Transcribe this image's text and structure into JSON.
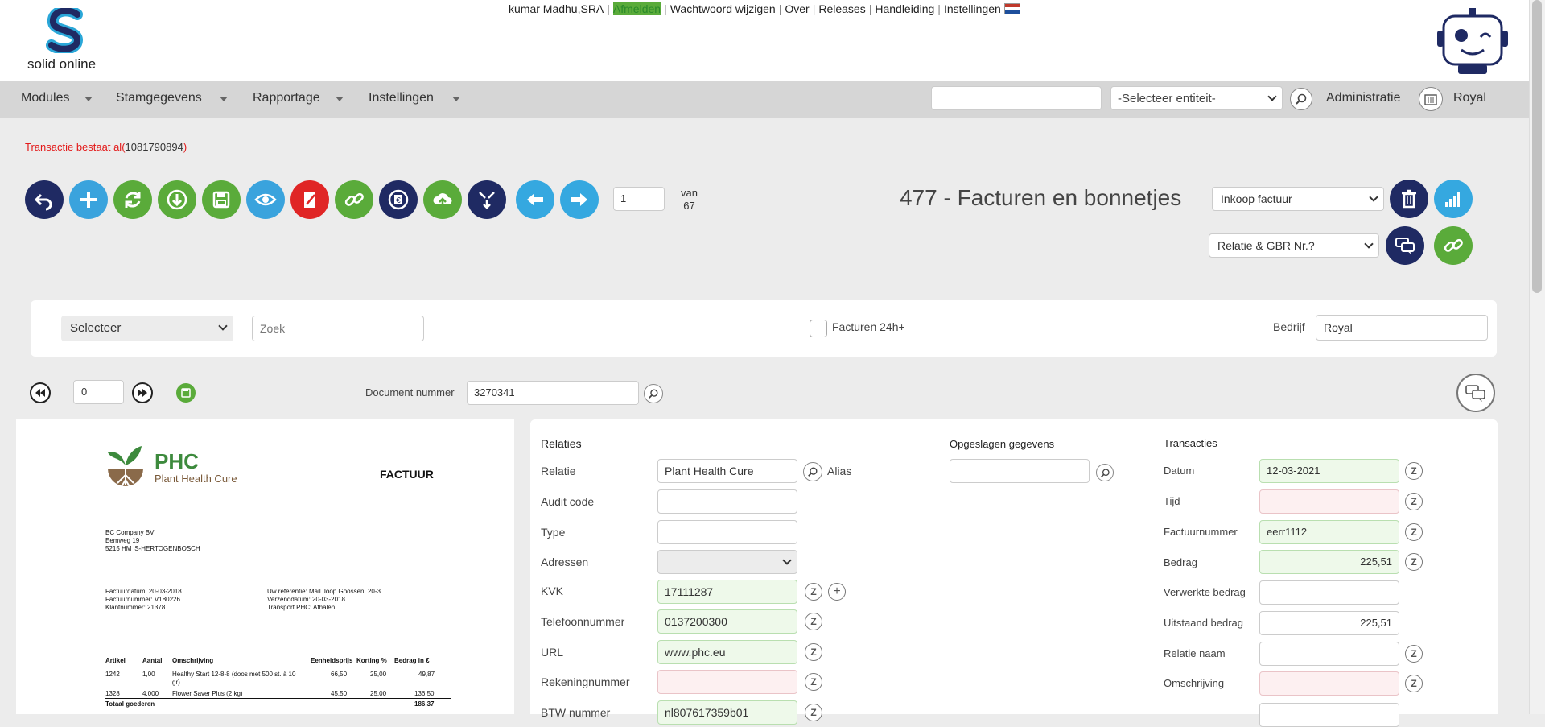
{
  "header": {
    "logo_text": "solid online",
    "user": "kumar Madhu,SRA",
    "links": [
      "Afmelden",
      "Wachtwoord wijzigen",
      "Over",
      "Releases",
      "Handleiding",
      "Instellingen"
    ]
  },
  "nav": {
    "menus": [
      "Modules",
      "Stamgegevens",
      "Rapportage",
      "Instellingen"
    ],
    "entity_select": "-Selecteer entiteit-",
    "admin_label": "Administratie",
    "company": "Royal"
  },
  "message": {
    "text": "Transactie bestaat al(",
    "number": "1081790894",
    "close": ")"
  },
  "toolbar": {
    "page_value": "1",
    "van_label": "van",
    "total_pages": "67",
    "title": "477 - Facturen en bonnetjes",
    "type_select": "Inkoop factuur",
    "relation_select": "Relatie & GBR Nr.?"
  },
  "filter": {
    "select": "Selecteer",
    "search_placeholder": "Zoek",
    "facturen_label": "Facturen 24h+",
    "bedrijf_label": "Bedrijf",
    "bedrijf_value": "Royal"
  },
  "docnav": {
    "index": "0",
    "docnum_label": "Document nummer",
    "docnum_value": "3270341"
  },
  "invoice": {
    "company_short": "PHC",
    "company_full": "Plant Health Cure",
    "doc_type": "FACTUUR",
    "address": [
      "BC Company BV",
      "Eemweg 19",
      "5215 HM  'S-HERTOGENBOSCH"
    ],
    "meta_left": [
      "Factuurdatum:  20-03-2018",
      "Factuurnummer: V180226",
      "Klantnummer: 21378"
    ],
    "meta_right": [
      "Uw referentie:  Mail Joop Goossen, 20-3",
      "Verzenddatum: 20-03-2018",
      "Transport PHC:  Afhalen"
    ],
    "headers": [
      "Artikel",
      "Aantal",
      "Omschrijving",
      "Eenheidsprijs",
      "Korting %",
      "Bedrag in €"
    ],
    "rows": [
      [
        "1242",
        "1,00",
        "Healthy Start 12-8-8 (doos met 500 st. à 10 gr)",
        "66,50",
        "25,00",
        "49,87"
      ],
      [
        "1328",
        "4,000",
        "Flower Saver Plus (2 kg)",
        "45,50",
        "25,00",
        "136,50"
      ]
    ],
    "total_label": "Totaal goederen",
    "total_value": "186,37"
  },
  "relaties": {
    "title": "Relaties",
    "relatie_label": "Relatie",
    "relatie_value": "Plant Health Cure",
    "alias_label": "Alias",
    "audit_label": "Audit code",
    "type_label": "Type",
    "adressen_label": "Adressen",
    "kvk_label": "KVK",
    "kvk_value": "17111287",
    "telefoon_label": "Telefoonnummer",
    "telefoon_value": "0137200300",
    "url_label": "URL",
    "url_value": "www.phc.eu",
    "rekening_label": "Rekeningnummer",
    "btw_label": "BTW nummer",
    "btw_value": "nl807617359b01"
  },
  "opgeslagen": {
    "title": "Opgeslagen gegevens"
  },
  "transacties": {
    "title": "Transacties",
    "datum_label": "Datum",
    "datum_value": "12-03-2021",
    "tijd_label": "Tijd",
    "factuurnummer_label": "Factuurnummer",
    "factuurnummer_value": "eerr1112",
    "bedrag_label": "Bedrag",
    "bedrag_value": "225,51",
    "verwerkte_label": "Verwerkte bedrag",
    "uitstaand_label": "Uitstaand bedrag",
    "uitstaand_value": "225,51",
    "relatienaam_label": "Relatie naam",
    "omschrijving_label": "Omschrijving"
  },
  "z_label": "Z",
  "colors": {
    "navy": "#1f2a63",
    "blue": "#3aa3dd",
    "green": "#5aab3a",
    "red": "#e02525",
    "error": "#e31919"
  }
}
